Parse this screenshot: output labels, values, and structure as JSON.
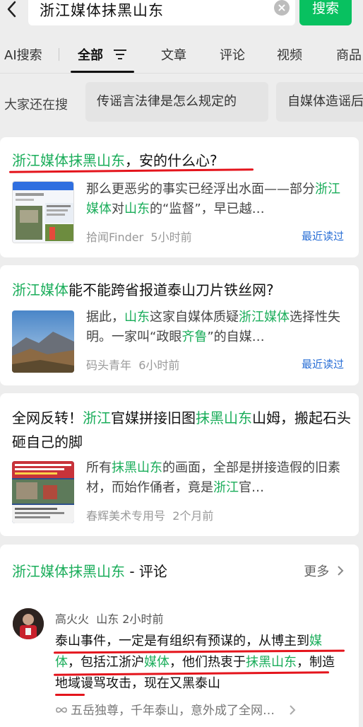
{
  "header": {
    "query": "浙江媒体抹黑山东",
    "search_button": "搜索"
  },
  "tabs": [
    "AI搜索",
    "全部",
    "文章",
    "评论",
    "视频",
    "商品"
  ],
  "suggestions": {
    "label": "大家还在搜",
    "items": [
      "传谣言法律是怎么规定的",
      "自媒体造谣后"
    ]
  },
  "results": [
    {
      "title_parts": [
        [
          "浙江媒体抹黑山东",
          true
        ],
        [
          "，安的什么心?",
          false
        ]
      ],
      "snippet_parts": [
        [
          "那么更恶劣的事实已经浮出水面——部分",
          false
        ],
        [
          "浙江媒体",
          true
        ],
        [
          "对",
          false
        ],
        [
          "山东",
          true
        ],
        [
          "的“监督”，早已越…",
          false
        ]
      ],
      "source": "拾闻Finder",
      "time": "5小时前",
      "badge": "最近读过"
    },
    {
      "title_parts": [
        [
          "浙江媒体",
          true
        ],
        [
          "能不能跨省报道泰山刀片铁丝网?",
          false
        ]
      ],
      "snippet_parts": [
        [
          "据此，",
          false
        ],
        [
          "山东",
          true
        ],
        [
          "这家自媒体质疑",
          false
        ],
        [
          "浙江媒体",
          true
        ],
        [
          "选择性失明。一家叫“政眼",
          false
        ],
        [
          "齐鲁",
          true
        ],
        [
          "”的自媒…",
          false
        ]
      ],
      "source": "码头青年",
      "time": "6小时前",
      "badge": "最近读过"
    },
    {
      "title_parts": [
        [
          "全网反转！",
          false
        ],
        [
          "浙江",
          true
        ],
        [
          "官媒拼接旧图",
          false
        ],
        [
          "抹黑山东",
          true
        ],
        [
          "山姆，搬起石头砸自己的脚",
          false
        ]
      ],
      "snippet_parts": [
        [
          "所有",
          false
        ],
        [
          "抹黑山东",
          true
        ],
        [
          "的画面，全部是拼接造假的旧素材，而始作俑者，竟是",
          false
        ],
        [
          "浙江",
          true
        ],
        [
          "官…",
          false
        ]
      ],
      "source": "春辉美术专用号",
      "time": "2个月前",
      "badge": ""
    }
  ],
  "comments": {
    "heading_hl": "浙江媒体抹黑山东",
    "heading_suffix": " - 评论",
    "more": "更多",
    "user": "高火火",
    "location": "山东",
    "time": "2小时前",
    "body_parts": [
      [
        "泰山事件，一定是有组织有预谋的，从博主到",
        false
      ],
      [
        "媒体",
        true
      ],
      [
        "，包括江浙沪",
        false
      ],
      [
        "媒体",
        true
      ],
      [
        "，他们热衷于",
        false
      ],
      [
        "抹黑山东",
        true
      ],
      [
        "，制造地域谩骂攻击，现在又黑泰山",
        false
      ]
    ],
    "source": "五岳独尊，千年泰山，意外成了全网…"
  },
  "colors": {
    "accent": "#08c160",
    "highlight": "#1aad5a",
    "link": "#2a6fd6",
    "annotation": "#e4141c"
  }
}
